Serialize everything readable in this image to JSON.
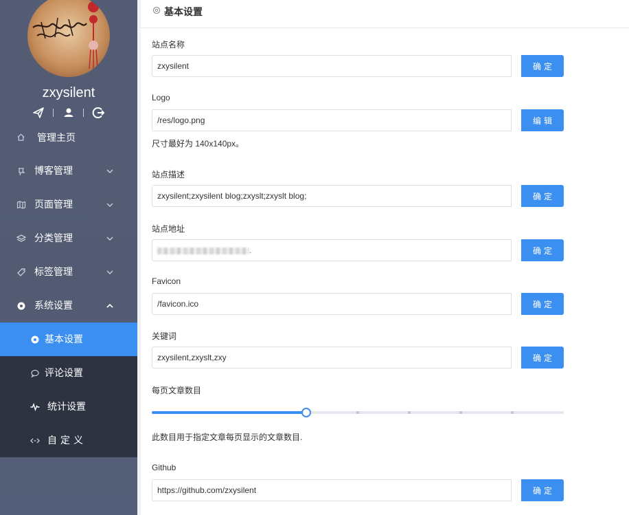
{
  "sidebar": {
    "username": "zxysilent",
    "menu": [
      {
        "label": "管理主页",
        "icon": "home-icon",
        "has_children": false
      },
      {
        "label": "博客管理",
        "icon": "pushpin-icon",
        "has_children": true
      },
      {
        "label": "页面管理",
        "icon": "map-icon",
        "has_children": true
      },
      {
        "label": "分类管理",
        "icon": "layers-icon",
        "has_children": true
      },
      {
        "label": "标签管理",
        "icon": "tag-icon",
        "has_children": true
      },
      {
        "label": "系统设置",
        "icon": "settings-icon",
        "has_children": true,
        "expanded": true
      }
    ],
    "submenu": [
      {
        "label": "基本设置",
        "icon": "settings-icon",
        "active": true
      },
      {
        "label": "评论设置",
        "icon": "comment-icon",
        "active": false
      },
      {
        "label": "统计设置",
        "icon": "pulse-icon",
        "active": false
      },
      {
        "label": "自定义",
        "icon": "code-icon",
        "active": false
      }
    ]
  },
  "header": {
    "title": "基本设置"
  },
  "form": {
    "site_name": {
      "label": "站点名称",
      "value": "zxysilent",
      "button": "确定"
    },
    "logo": {
      "label": "Logo",
      "value": "/res/logo.png",
      "button": "编辑",
      "hint": "尺寸最好为 140x140px。"
    },
    "site_desc": {
      "label": "站点描述",
      "value": "zxysilent;zxysilent blog;zxyslt;zxyslt blog;",
      "button": "确定"
    },
    "site_url": {
      "label": "站点地址",
      "value_suffix": ".",
      "button": "确定"
    },
    "favicon": {
      "label": "Favicon",
      "value": "/favicon.ico",
      "button": "确定"
    },
    "keywords": {
      "label": "关键词",
      "value": "zxysilent,zxyslt,zxy",
      "button": "确定"
    },
    "page_size": {
      "label": "每页文章数目",
      "hint": "此数目用于指定文章每页显示的文章数目.",
      "slider_fraction": 0.375,
      "steps": 8
    },
    "github": {
      "label": "Github",
      "value": "https://github.com/zxysilent",
      "button": "确定"
    }
  },
  "colors": {
    "primary": "#3b8ff0",
    "sidebar_bg": "#545d75",
    "submenu_bg": "#2e3341"
  }
}
